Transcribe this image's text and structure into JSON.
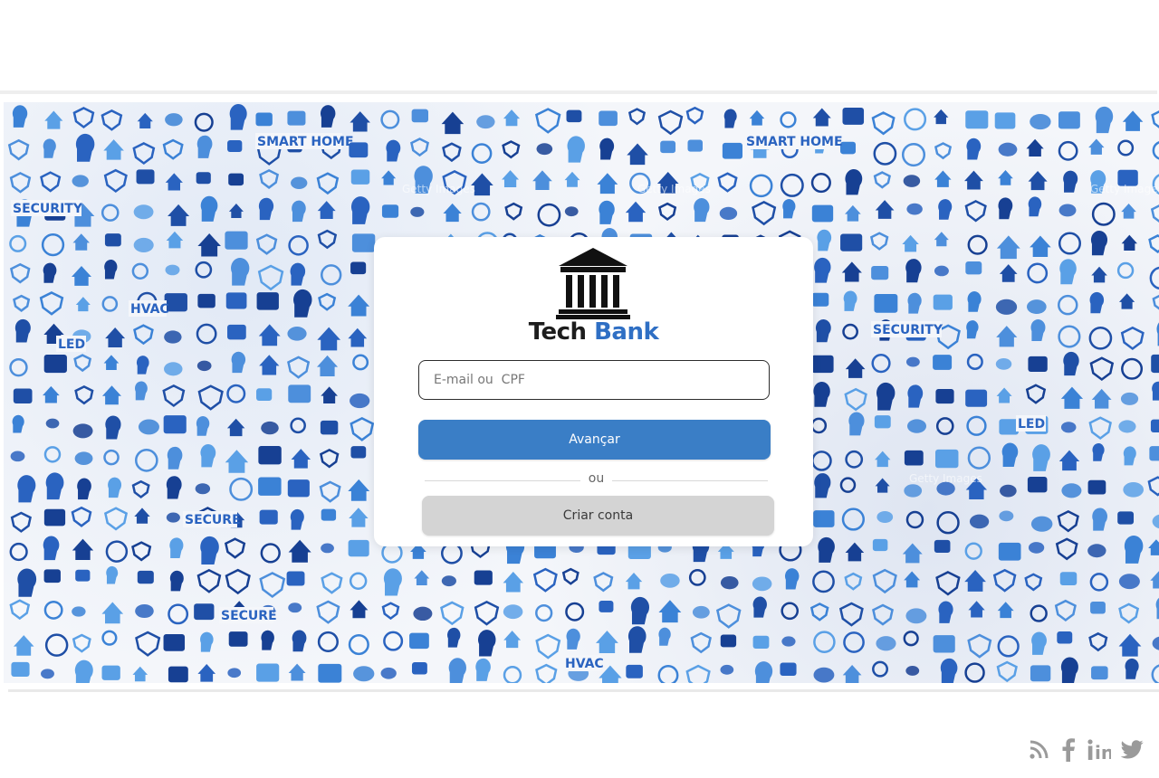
{
  "brand": {
    "name_part1": "Tech",
    "name_part2": " Bank",
    "logo_icon": "bank-building-icon",
    "accent_color": "#2f6fc4"
  },
  "banner": {
    "description_icon": "smart-home-icons-pattern",
    "watermark_text": "Getty Images",
    "pattern_labels": [
      "SMART HOME",
      "SECURITY",
      "HVAC",
      "LED",
      "SECURE"
    ]
  },
  "login": {
    "identifier_placeholder": "E-mail ou  CPF",
    "next_label": "Avançar",
    "or_label": "ou",
    "create_account_label": "Criar conta",
    "primary_color": "#3a7ec6",
    "secondary_color": "#d4d4d4"
  },
  "footer": {
    "social_icons": [
      "rss-icon",
      "facebook-icon",
      "linkedin-icon",
      "twitter-icon"
    ],
    "linkedin_text": "in"
  }
}
